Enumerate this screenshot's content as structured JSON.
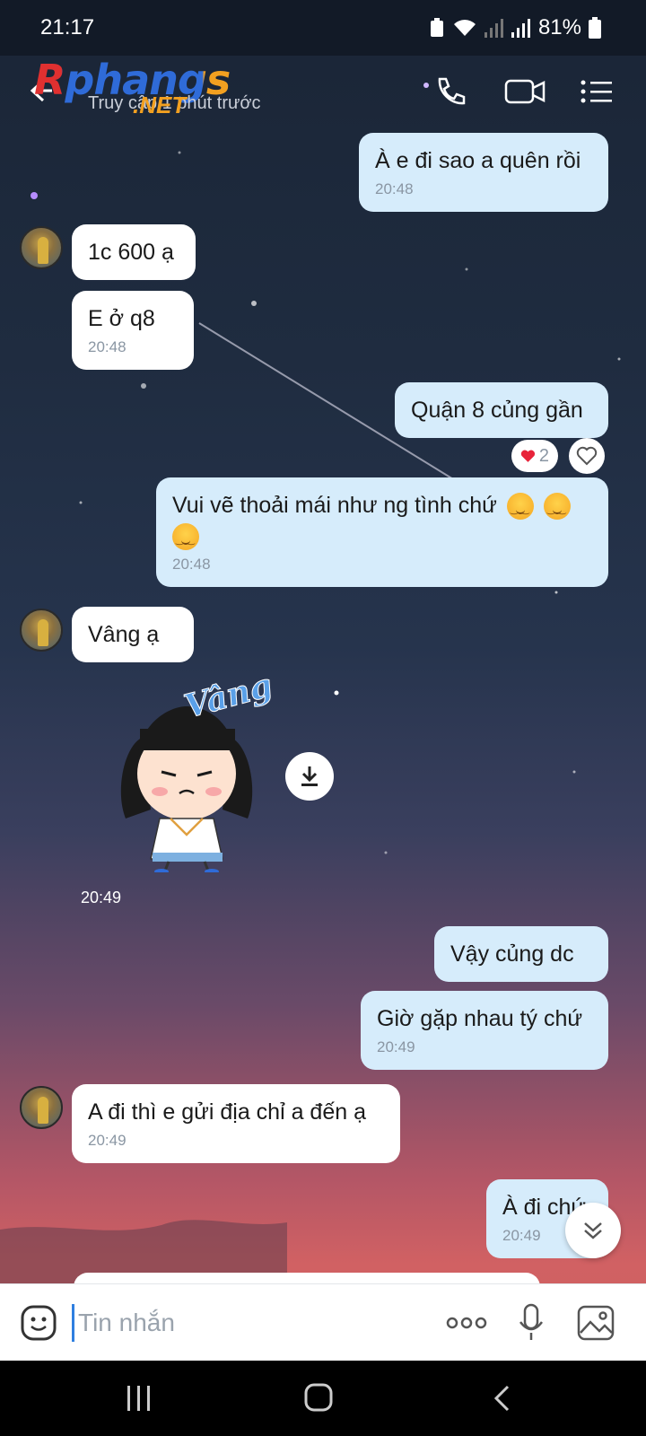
{
  "status": {
    "time": "21:17",
    "battery": "81%"
  },
  "header": {
    "logo_main": "Rphangs",
    "logo_net": ".NET",
    "subtitle": "Truy cập 1 phút trước"
  },
  "messages": [
    {
      "dir": "out",
      "text": "À e đi sao a quên rồi",
      "time": "20:48"
    },
    {
      "dir": "in",
      "text": "1c 600 ạ",
      "time": ""
    },
    {
      "dir": "in",
      "text": "E ở q8",
      "time": "20:48"
    },
    {
      "dir": "out",
      "text": "Quận 8 củng gần",
      "time": ""
    },
    {
      "dir": "out",
      "text": "Vui vẽ thoải mái như ng tình chứ",
      "time": "20:48"
    },
    {
      "dir": "in",
      "text": "Vâng ạ",
      "time": ""
    },
    {
      "dir": "in",
      "text": "Vậy củng dc",
      "time": ""
    },
    {
      "dir": "out",
      "text": "Giờ gặp nhau tý chứ",
      "time": "20:49"
    },
    {
      "dir": "in",
      "text": "A đi thì e gửi địa chỉ a đến ạ",
      "time": "20:49"
    },
    {
      "dir": "out",
      "text": "À đi chứ",
      "time": "20:49"
    }
  ],
  "reaction": {
    "count": "2"
  },
  "sticker": {
    "caption": "Vâng",
    "time": "20:49"
  },
  "composer": {
    "placeholder": "Tin nhắn"
  },
  "colors": {
    "outgoing_bubble": "#d6ecfb",
    "incoming_bubble": "#ffffff",
    "accent": "#2f7fe0"
  }
}
